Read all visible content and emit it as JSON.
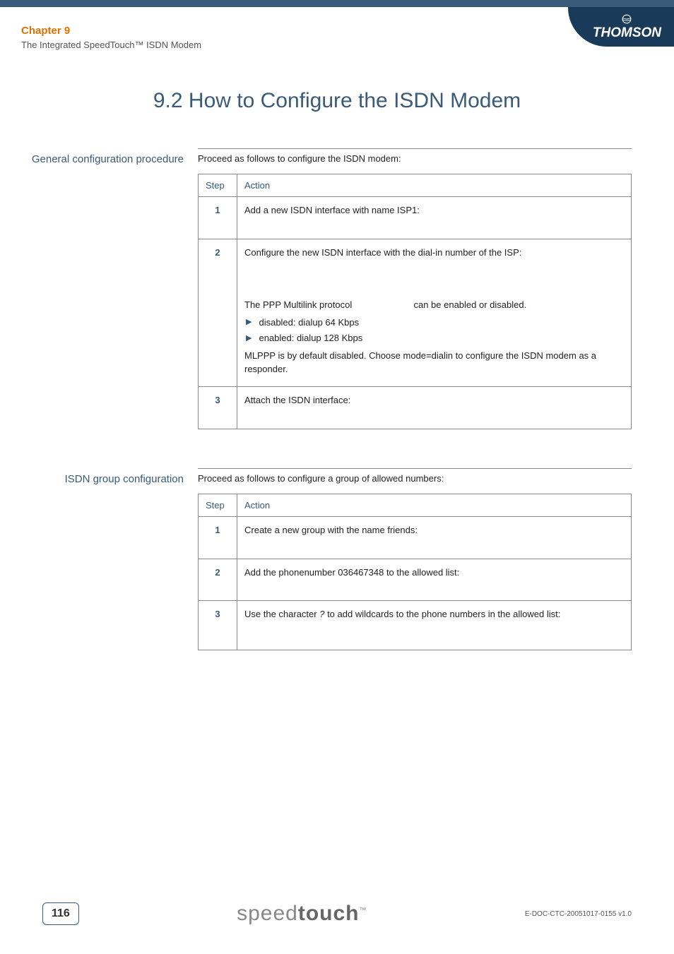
{
  "header": {
    "chapter_label": "Chapter 9",
    "chapter_title": "The Integrated SpeedTouch™ ISDN Modem",
    "brand": "THOMSON"
  },
  "section_title": "9.2  How to Configure the ISDN Modem",
  "block1": {
    "label": "General configuration procedure",
    "intro": "Proceed as follows to configure the ISDN modem:",
    "header_step": "Step",
    "header_action": "Action",
    "row1_step": "1",
    "row1_action": "Add a new ISDN interface with name ISP1:",
    "row2_step": "2",
    "row2_intro": "Configure the new ISDN interface with the dial-in number of the ISP:",
    "row2_ppp_prefix": "The PPP Multilink protocol",
    "row2_ppp_suffix": "can be enabled or disabled.",
    "row2_bullet1": "disabled: dialup 64 Kbps",
    "row2_bullet2": "enabled: dialup 128 Kbps",
    "row2_mlppp": "MLPPP is by default disabled. Choose mode=dialin to configure the ISDN modem as a responder.",
    "row3_step": "3",
    "row3_action": "Attach the ISDN interface:"
  },
  "block2": {
    "label": "ISDN group configuration",
    "intro": "Proceed as follows to configure a group of allowed numbers:",
    "header_step": "Step",
    "header_action": "Action",
    "row1_step": "1",
    "row1_action": "Create a new group with the name friends:",
    "row2_step": "2",
    "row2_action": "Add the phonenumber 036467348 to the allowed list:",
    "row3_step": "3",
    "row3_prefix": "Use the character ",
    "row3_char": "?",
    "row3_suffix": " to add wildcards to the phone numbers in the allowed list:"
  },
  "footer": {
    "page_number": "116",
    "logo_light": "speed",
    "logo_bold": "touch",
    "logo_tm": "™",
    "doc_id": "E-DOC-CTC-20051017-0155 v1.0"
  }
}
